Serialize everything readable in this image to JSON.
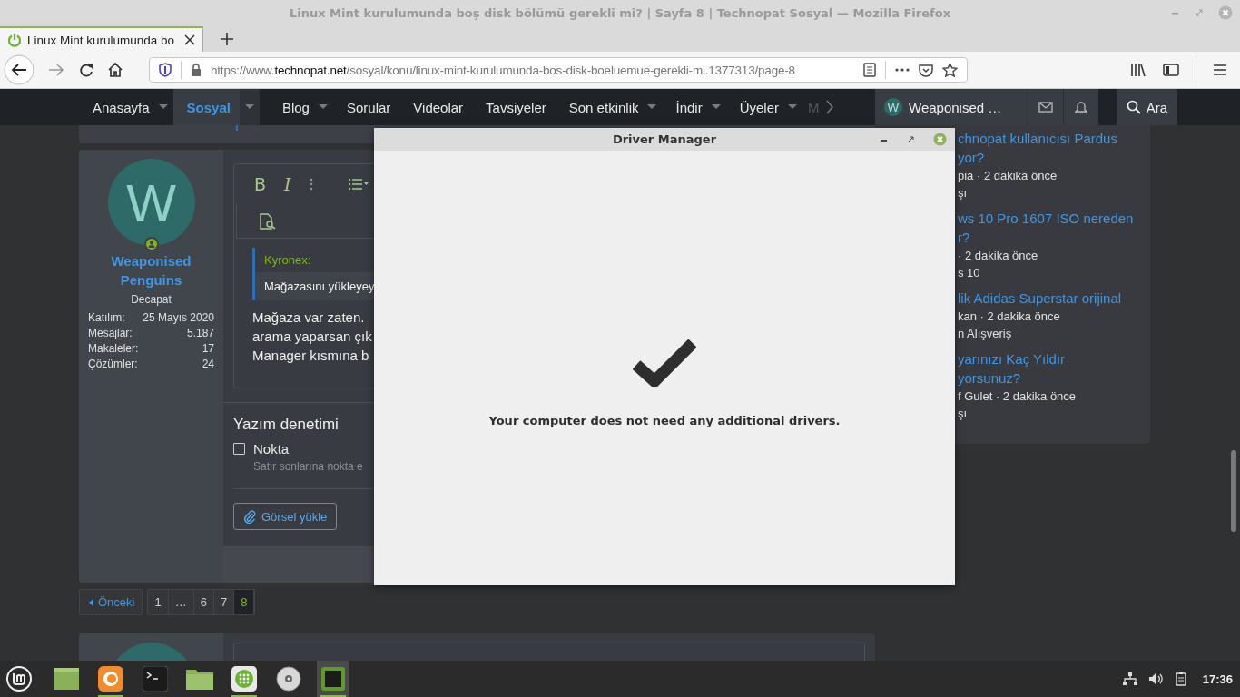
{
  "window": {
    "title": "Linux Mint kurulumunda boş disk bölümü gerekli mi? | Sayfa 8 | Technopat Sosyal — Mozilla Firefox"
  },
  "tabs": [
    {
      "label": "Linux Mint kurulumunda bo",
      "selected": true
    }
  ],
  "address_bar": {
    "prefix": "https://www.",
    "host": "technopat.net",
    "path": "/sosyal/konu/linux-mint-kurulumunda-bos-disk-boeluemue-gerekli-mi.1377313/page-8"
  },
  "site_nav": {
    "items": [
      {
        "label": "Anasayfa",
        "dropdown": true,
        "selected": false
      },
      {
        "label": "Sosyal",
        "dropdown": true,
        "selected": true
      },
      {
        "label": "Blog",
        "dropdown": true,
        "selected": false
      },
      {
        "label": "Sorular",
        "dropdown": false,
        "selected": false
      },
      {
        "label": "Videolar",
        "dropdown": false,
        "selected": false
      },
      {
        "label": "Tavsiyeler",
        "dropdown": false,
        "selected": false
      },
      {
        "label": "Son etkinlik",
        "dropdown": true,
        "selected": false
      },
      {
        "label": "İndir",
        "dropdown": true,
        "selected": false
      },
      {
        "label": "Üyeler",
        "dropdown": true,
        "selected": false
      }
    ],
    "more_label": "M",
    "user_initial": "W",
    "user_name": "Weaponised …",
    "search_label": "Ara"
  },
  "post": {
    "author": {
      "initial": "W",
      "name": "Weaponised Penguins",
      "title": "Decapat",
      "stats": [
        {
          "label": "Katılım:",
          "value": "25 Mayıs 2020"
        },
        {
          "label": "Mesajlar:",
          "value": "5.187"
        },
        {
          "label": "Makaleler:",
          "value": "17"
        },
        {
          "label": "Çözümler:",
          "value": "24"
        }
      ]
    },
    "editor": {
      "bold": "B",
      "italic": "I",
      "quote_author": "Kyronex:",
      "quote_text": "Mağazasını yükleyey",
      "body_lines": [
        "Mağaza var zaten.",
        "arama yaparsan çık",
        "Manager kısmına b"
      ]
    },
    "spellcheck": {
      "heading": "Yazım denetimi",
      "label": "Nokta",
      "checked": false,
      "hint": "Satır sonlarına nokta e"
    },
    "upload_button": "Görsel yükle"
  },
  "pagination": {
    "prev": "Önceki",
    "pages": [
      {
        "label": "1",
        "selected": false
      },
      {
        "label": "…",
        "selected": false
      },
      {
        "label": "6",
        "selected": false
      },
      {
        "label": "7",
        "selected": false
      },
      {
        "label": "8",
        "selected": true
      }
    ]
  },
  "sidebar": {
    "threads": [
      {
        "title_lines": [
          "chnopat kullanıcısı Pardus",
          "yor?"
        ],
        "meta": "pia · 2 dakika önce",
        "forum": "şı"
      },
      {
        "title_lines": [
          "ws 10 Pro 1607 ISO nereden",
          "r?"
        ],
        "meta": "· 2 dakika önce",
        "forum": "s 10"
      },
      {
        "title_lines": [
          "lik Adidas Superstar orijinal"
        ],
        "meta": "kan · 2 dakika önce",
        "forum": "n Alışveriş"
      },
      {
        "title_lines": [
          "yarınızı Kaç Yıldır",
          "yorsunuz?"
        ],
        "meta": "f Gulet · 2 dakika önce",
        "forum": "şı"
      }
    ]
  },
  "dialog": {
    "title": "Driver Manager",
    "message": "Your computer does not need any additional drivers."
  },
  "taskbar": {
    "apps": [
      {
        "kind": "desktop",
        "active": false,
        "running": false
      },
      {
        "kind": "firefox",
        "active": false,
        "running": true
      },
      {
        "kind": "terminal",
        "active": false,
        "running": false
      },
      {
        "kind": "folder",
        "active": false,
        "running": false
      },
      {
        "kind": "grid",
        "active": false,
        "running": true
      },
      {
        "kind": "disc",
        "active": false,
        "running": false
      },
      {
        "kind": "chip",
        "active": true,
        "running": true
      }
    ],
    "clock": "17:36"
  }
}
